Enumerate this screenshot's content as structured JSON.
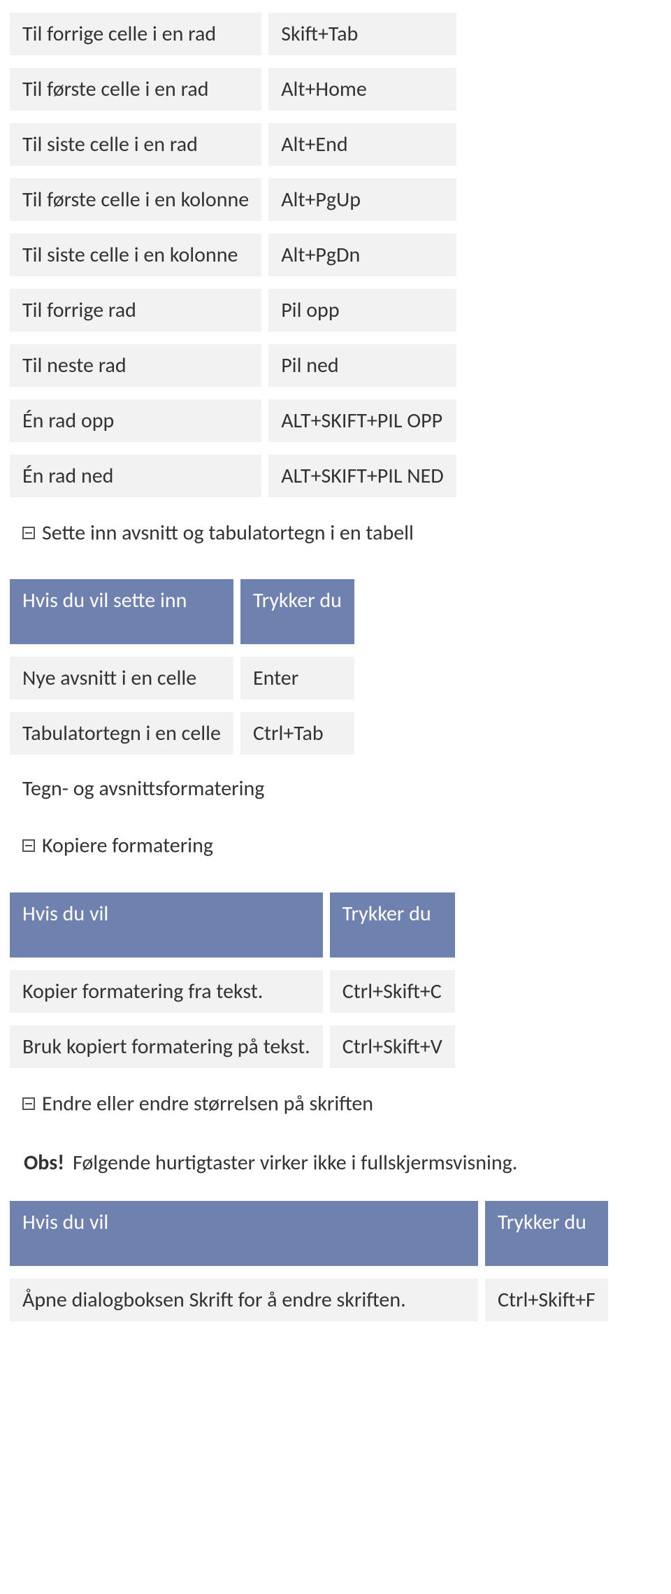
{
  "t1": {
    "rows": [
      {
        "a": "Til forrige celle i en rad",
        "b": "Skift+Tab"
      },
      {
        "a": "Til første celle i en rad",
        "b": "Alt+Home"
      },
      {
        "a": "Til siste celle i en rad",
        "b": "Alt+End"
      },
      {
        "a": "Til første celle i en kolonne",
        "b": "Alt+PgUp"
      },
      {
        "a": "Til siste celle i en kolonne",
        "b": "Alt+PgDn"
      },
      {
        "a": "Til forrige rad",
        "b": "Pil opp"
      },
      {
        "a": "Til neste rad",
        "b": "Pil ned"
      },
      {
        "a": "Én rad opp",
        "b": "ALT+SKIFT+PIL OPP"
      },
      {
        "a": "Én rad ned",
        "b": "ALT+SKIFT+PIL NED"
      }
    ]
  },
  "sec1": "Sette inn avsnitt og tabulatortegn i en tabell",
  "t2": {
    "head": {
      "a": "Hvis du vil sette inn",
      "b": "Trykker du"
    },
    "rows": [
      {
        "a": "Nye avsnitt i en celle",
        "b": "Enter"
      },
      {
        "a": "Tabulatortegn i en celle",
        "b": "Ctrl+Tab"
      }
    ]
  },
  "h2": "Tegn- og avsnittsformatering",
  "sec2": "Kopiere formatering",
  "t3": {
    "head": {
      "a": "Hvis du vil",
      "b": "Trykker du"
    },
    "rows": [
      {
        "a": "Kopier formatering fra tekst.",
        "b": "Ctrl+Skift+C"
      },
      {
        "a": "Bruk kopiert formatering på tekst.",
        "b": "Ctrl+Skift+V"
      }
    ]
  },
  "sec3": "Endre eller endre størrelsen på skriften",
  "obs": {
    "label": "Obs!",
    "text": "Følgende hurtigtaster virker ikke i fullskjermsvisning."
  },
  "t4": {
    "head": {
      "a": "Hvis du vil",
      "b": "Trykker du"
    },
    "rows": [
      {
        "a": "Åpne dialogboksen Skrift for å endre skriften.",
        "b": "Ctrl+Skift+F"
      }
    ]
  }
}
